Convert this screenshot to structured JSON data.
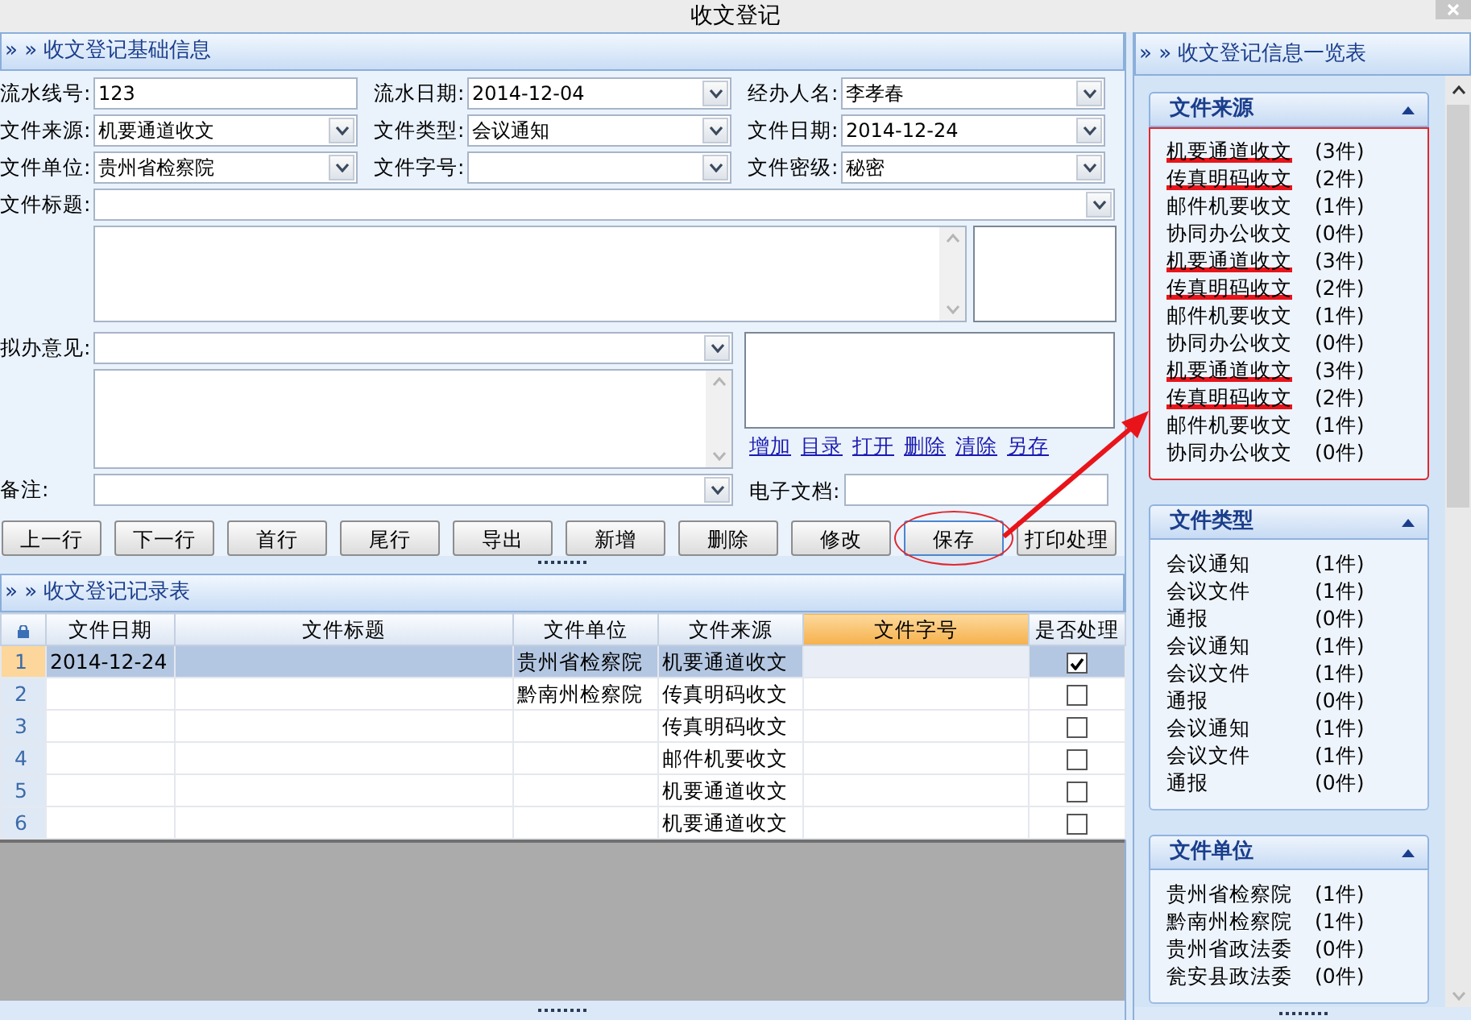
{
  "window": {
    "title": "收文登记"
  },
  "basic_info": {
    "title": "» » 收文登记基础信息",
    "field_rows": [
      [
        {
          "label": "流水线号:",
          "kind": "text",
          "value": "123"
        },
        {
          "label": "流水日期:",
          "kind": "combo",
          "value": "2014-12-04"
        },
        {
          "label": "经办人名:",
          "kind": "combo",
          "value": "李孝春"
        }
      ],
      [
        {
          "label": "文件来源:",
          "kind": "combo",
          "value": "机要通道收文"
        },
        {
          "label": "文件类型:",
          "kind": "combo",
          "value": "会议通知"
        },
        {
          "label": "文件日期:",
          "kind": "combo",
          "value": "2014-12-24"
        }
      ],
      [
        {
          "label": "文件单位:",
          "kind": "combo",
          "value": "贵州省检察院"
        },
        {
          "label": "文件字号:",
          "kind": "combo"
        },
        {
          "label": "文件密级:",
          "kind": "combo",
          "value": "秘密"
        }
      ]
    ],
    "title_field": {
      "label": "文件标题:"
    },
    "opinion": {
      "label": "拟办意见:"
    },
    "attachment_links": [
      "增加",
      "目录",
      "打开",
      "删除",
      "清除",
      "另存"
    ],
    "remark": {
      "label": "备注:"
    },
    "e_document": {
      "label": "电子文档:"
    },
    "buttons": [
      {
        "label": "上一行",
        "circled": false
      },
      {
        "label": "下一行",
        "circled": false
      },
      {
        "label": "首行",
        "circled": false
      },
      {
        "label": "尾行",
        "circled": false
      },
      {
        "label": "导出",
        "circled": false
      },
      {
        "label": "新增",
        "circled": false
      },
      {
        "label": "删除",
        "circled": false
      },
      {
        "label": "修改",
        "circled": false
      },
      {
        "label": "保存",
        "circled": true
      },
      {
        "label": "打印处理",
        "circled": false
      }
    ]
  },
  "records": {
    "title": "» » 收文登记记录表",
    "columns": [
      {
        "label": "文件日期",
        "selected": false
      },
      {
        "label": "文件标题",
        "selected": false
      },
      {
        "label": "文件单位",
        "selected": false
      },
      {
        "label": "文件来源",
        "selected": false
      },
      {
        "label": "文件字号",
        "selected": true
      },
      {
        "label": "是否处理",
        "selected": false
      }
    ],
    "rows": [
      {
        "number": "1",
        "date": "2014-12-24",
        "unit": "贵州省检察院",
        "source": "机要通道收文",
        "processed": true,
        "selected": true
      },
      {
        "number": "2",
        "unit": "黔南州检察院",
        "source": "传真明码收文",
        "processed": false,
        "selected": false
      },
      {
        "number": "3",
        "source": "传真明码收文",
        "processed": false,
        "selected": false
      },
      {
        "number": "4",
        "source": "邮件机要收文",
        "processed": false,
        "selected": false
      },
      {
        "number": "5",
        "source": "机要通道收文",
        "processed": false,
        "selected": false
      },
      {
        "number": "6",
        "source": "机要通道收文",
        "processed": false,
        "selected": false
      }
    ]
  },
  "overview": {
    "title": "» » 收文登记信息一览表",
    "groups": [
      {
        "title": "文件来源",
        "expanded": true,
        "outlined": true,
        "items": [
          {
            "name": "机要通道收文",
            "count": "(3件)",
            "marked": true
          },
          {
            "name": "传真明码收文",
            "count": "(2件)",
            "marked": true
          },
          {
            "name": "邮件机要收文",
            "count": "(1件)",
            "marked": false
          },
          {
            "name": "协同办公收文",
            "count": "(0件)",
            "marked": false
          },
          {
            "name": "机要通道收文",
            "count": "(3件)",
            "marked": true
          },
          {
            "name": "传真明码收文",
            "count": "(2件)",
            "marked": true
          },
          {
            "name": "邮件机要收文",
            "count": "(1件)",
            "marked": false
          },
          {
            "name": "协同办公收文",
            "count": "(0件)",
            "marked": false
          },
          {
            "name": "机要通道收文",
            "count": "(3件)",
            "marked": true
          },
          {
            "name": "传真明码收文",
            "count": "(2件)",
            "marked": true
          },
          {
            "name": "邮件机要收文",
            "count": "(1件)",
            "marked": false
          },
          {
            "name": "协同办公收文",
            "count": "(0件)",
            "marked": false
          }
        ]
      },
      {
        "title": "文件类型",
        "expanded": true,
        "outlined": false,
        "items": [
          {
            "name": "会议通知",
            "count": "(1件)",
            "marked": false
          },
          {
            "name": "会议文件",
            "count": "(1件)",
            "marked": false
          },
          {
            "name": "通报",
            "count": "(0件)",
            "marked": false
          },
          {
            "name": "会议通知",
            "count": "(1件)",
            "marked": false
          },
          {
            "name": "会议文件",
            "count": "(1件)",
            "marked": false
          },
          {
            "name": "通报",
            "count": "(0件)",
            "marked": false
          },
          {
            "name": "会议通知",
            "count": "(1件)",
            "marked": false
          },
          {
            "name": "会议文件",
            "count": "(1件)",
            "marked": false
          },
          {
            "name": "通报",
            "count": "(0件)",
            "marked": false
          }
        ]
      },
      {
        "title": "文件单位",
        "expanded": true,
        "outlined": false,
        "items": [
          {
            "name": "贵州省检察院",
            "count": "(1件)",
            "marked": false
          },
          {
            "name": "黔南州检察院",
            "count": "(1件)",
            "marked": false
          },
          {
            "name": "贵州省政法委",
            "count": "(0件)",
            "marked": false
          },
          {
            "name": "瓮安县政法委",
            "count": "(0件)",
            "marked": false
          }
        ]
      }
    ]
  }
}
